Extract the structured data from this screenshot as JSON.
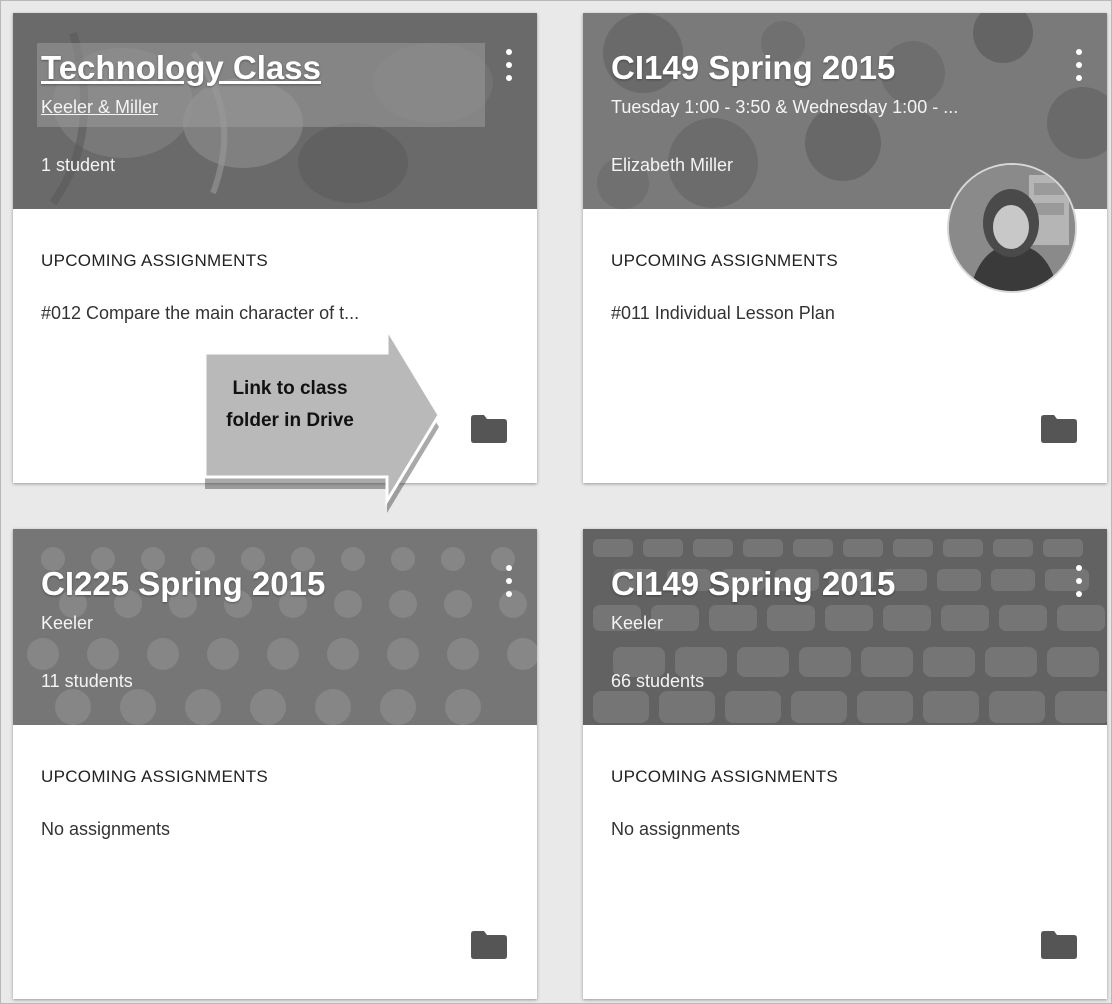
{
  "cards": [
    {
      "title": "Technology Class",
      "subtitle": "Keeler & Miller",
      "count": "1 student",
      "section_label": "UPCOMING ASSIGNMENTS",
      "assignment": "#012 Compare the main character of t..."
    },
    {
      "title": "CI149 Spring 2015",
      "subtitle": "Tuesday 1:00 - 3:50 & Wednesday 1:00 - ...",
      "count": "Elizabeth Miller",
      "section_label": "UPCOMING ASSIGNMENTS",
      "assignment": "#011 Individual Lesson Plan"
    },
    {
      "title": "CI225 Spring 2015",
      "subtitle": "Keeler",
      "count": "11 students",
      "section_label": "UPCOMING ASSIGNMENTS",
      "assignment": "No assignments"
    },
    {
      "title": "CI149 Spring 2015",
      "subtitle": "Keeler",
      "count": "66 students",
      "section_label": "UPCOMING ASSIGNMENTS",
      "assignment": "No assignments"
    }
  ],
  "callout": {
    "text": "Link to class folder in Drive"
  },
  "icons": {
    "menu": "more-vert-icon",
    "folder": "folder-icon"
  },
  "colors": {
    "background": "#e9e9e9",
    "card": "#ffffff",
    "banner_1": "#6e6e6e",
    "banner_2": "#777777",
    "banner_3": "#7c7c7c",
    "banner_4": "#6a6a6a",
    "callout": "#b8b8b8"
  }
}
